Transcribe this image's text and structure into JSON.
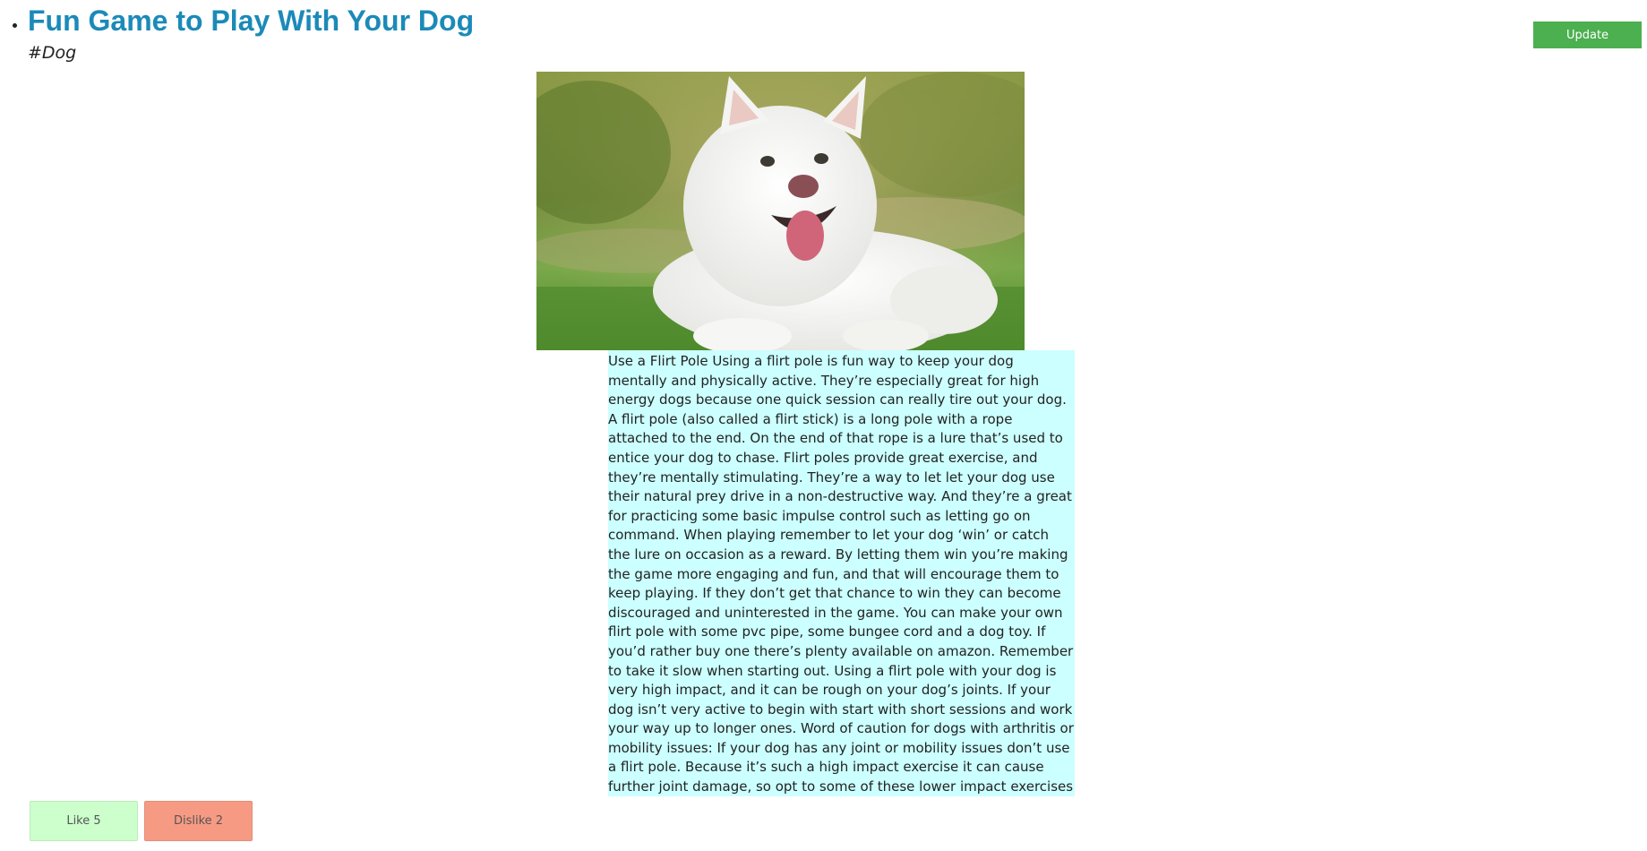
{
  "post": {
    "title": "Fun Game to Play With Your Dog",
    "tag": "#Dog",
    "body": "Use a Flirt Pole Using a flirt pole is fun way to keep your dog mentally and physically active. They’re especially great for high energy dogs because one quick session can really tire out your dog. A flirt pole (also called a flirt stick) is a long pole with a rope attached to the end. On the end of that rope is a lure that’s used to entice your dog to chase. Flirt poles provide great exercise, and they’re mentally stimulating. They’re a way to let let your dog use their natural prey drive in a non-destructive way. And they’re a great for practicing some basic impulse control such as letting go on command. When playing remember to let your dog ‘win’ or catch the lure on occasion as a reward. By letting them win you’re making the game more engaging and fun, and that will encourage them to keep playing. If they don’t get that chance to win they can become discouraged and uninterested in the game. You can make your own flirt pole with some pvc pipe, some bungee cord and a dog toy. If you’d rather buy one there’s plenty available on amazon. Remember to take it slow when starting out. Using a flirt pole with your dog is very high impact, and it can be rough on your dog’s joints. If your dog isn’t very active to begin with start with short sessions and work your way up to longer ones. Word of caution for dogs with arthritis or mobility issues: If your dog has any joint or mobility issues don’t use a flirt pole. Because it’s such a high impact exercise it can cause further joint damage, so opt to some of these lower impact exercises instead."
  },
  "toolbar": {
    "update_label": "Update"
  },
  "votes": {
    "like_label": "Like 5",
    "dislike_label": "Dislike 2"
  },
  "image": {
    "subject": "white fluffy dog lying on grass"
  },
  "colors": {
    "title": "#1b8ab8",
    "update_button": "#4caf50",
    "body_background": "#ccffff",
    "like_background": "#ccffcc",
    "dislike_background": "#f79a84"
  },
  "icons": {
    "list_marker": "bullet-icon"
  }
}
